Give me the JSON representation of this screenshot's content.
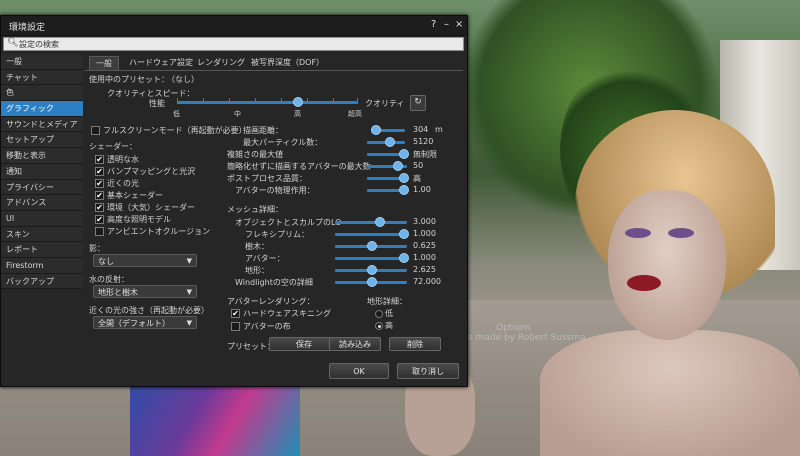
{
  "window": {
    "title": "環境設定",
    "help": "?",
    "minimize": "–",
    "close": "×"
  },
  "search": {
    "placeholder": "設定の検索"
  },
  "sidebar": {
    "items": [
      {
        "label": "一般"
      },
      {
        "label": "チャット"
      },
      {
        "label": "色"
      },
      {
        "label": "グラフィック"
      },
      {
        "label": "サウンドとメディア"
      },
      {
        "label": "セットアップ"
      },
      {
        "label": "移動と表示"
      },
      {
        "label": "通知"
      },
      {
        "label": "プライバシー"
      },
      {
        "label": "アドバンス"
      },
      {
        "label": "UI"
      },
      {
        "label": "スキン"
      },
      {
        "label": "レポート"
      },
      {
        "label": "Firestorm"
      },
      {
        "label": "バックアップ"
      }
    ],
    "selected_index": 3
  },
  "tabs": [
    {
      "label": "一般"
    },
    {
      "label": "ハードウェア設定"
    },
    {
      "label": "レンダリング"
    },
    {
      "label": "被写界深度（DOF）"
    }
  ],
  "preset": {
    "label": "使用中のプリセット：",
    "value": "（なし）"
  },
  "quality": {
    "label": "クオリティとスピード：",
    "left": "性能",
    "right": "クオリティ",
    "ticks": [
      "低",
      "中",
      "高",
      "超高"
    ],
    "level_fraction": 0.5
  },
  "fullscreen": {
    "label": "フルスクリーンモード（再起動が必要）",
    "checked": false
  },
  "shaders": {
    "label": "シェーダー：",
    "items": [
      {
        "label": "透明な水",
        "checked": true
      },
      {
        "label": "バンプマッピングと光沢",
        "checked": true
      },
      {
        "label": "近くの光",
        "checked": true
      },
      {
        "label": "基本シェーダー",
        "checked": true
      },
      {
        "label": "環境（大気）シェーダー",
        "checked": true
      },
      {
        "label": "高度な照明モデル",
        "checked": true
      },
      {
        "label": "アンビエントオクルージョン",
        "checked": false
      }
    ]
  },
  "shadows": {
    "label": "影：",
    "value": "なし"
  },
  "water": {
    "label": "水の反射：",
    "value": "地形と樹木"
  },
  "lights": {
    "label": "近くの光の強さ（再起動が必要）",
    "value": "全開（デフォルト）"
  },
  "right_settings": [
    {
      "label": "描画距離：",
      "value": "304",
      "unit": "m",
      "fraction": 0.13
    },
    {
      "label": "最大パーティクル数：",
      "value": "5120",
      "fraction": 0.55
    },
    {
      "label": "複雑さの最大値",
      "value": "無制限",
      "fraction": 1.0
    },
    {
      "label": "簡略化せずに描画するアバターの最大数",
      "value": "50",
      "fraction": 0.9
    },
    {
      "label": "ポストプロセス品質：",
      "value": "高",
      "fraction": 1.0
    },
    {
      "label": "アバターの物理作用：",
      "value": "1.00",
      "fraction": 1.0
    }
  ],
  "mesh": {
    "label": "メッシュ詳細：",
    "items": [
      {
        "label": "オブジェクトとスカルプのLO",
        "value": "3.000",
        "fraction": 0.7
      },
      {
        "label": "フレキシプリム：",
        "value": "1.000",
        "fraction": 1.0
      },
      {
        "label": "樹木：",
        "value": "0.625",
        "fraction": 0.55
      },
      {
        "label": "アバター：",
        "value": "1.000",
        "fraction": 1.0
      },
      {
        "label": "地形：",
        "value": "2.625",
        "fraction": 0.5
      },
      {
        "label": "Windlightの空の詳細",
        "value": "72.000",
        "fraction": 0.5
      }
    ]
  },
  "avatar_render": {
    "label": "アバターレンダリング：",
    "items": [
      {
        "label": "ハードウェアスキニング",
        "checked": true
      },
      {
        "label": "アバターの布",
        "checked": false
      }
    ]
  },
  "terrain_detail": {
    "label": "地形詳細：",
    "options": [
      "低",
      "高"
    ],
    "selected": "高"
  },
  "presets_row": {
    "label": "プリセット：",
    "save": "保存",
    "load": "読み込み",
    "delete": "削除"
  },
  "footer": {
    "ok": "OK",
    "cancel": "取り消し"
  },
  "scene": {
    "nametag_1": "Options",
    "nametag_2": "s made by Robert Sussma"
  }
}
